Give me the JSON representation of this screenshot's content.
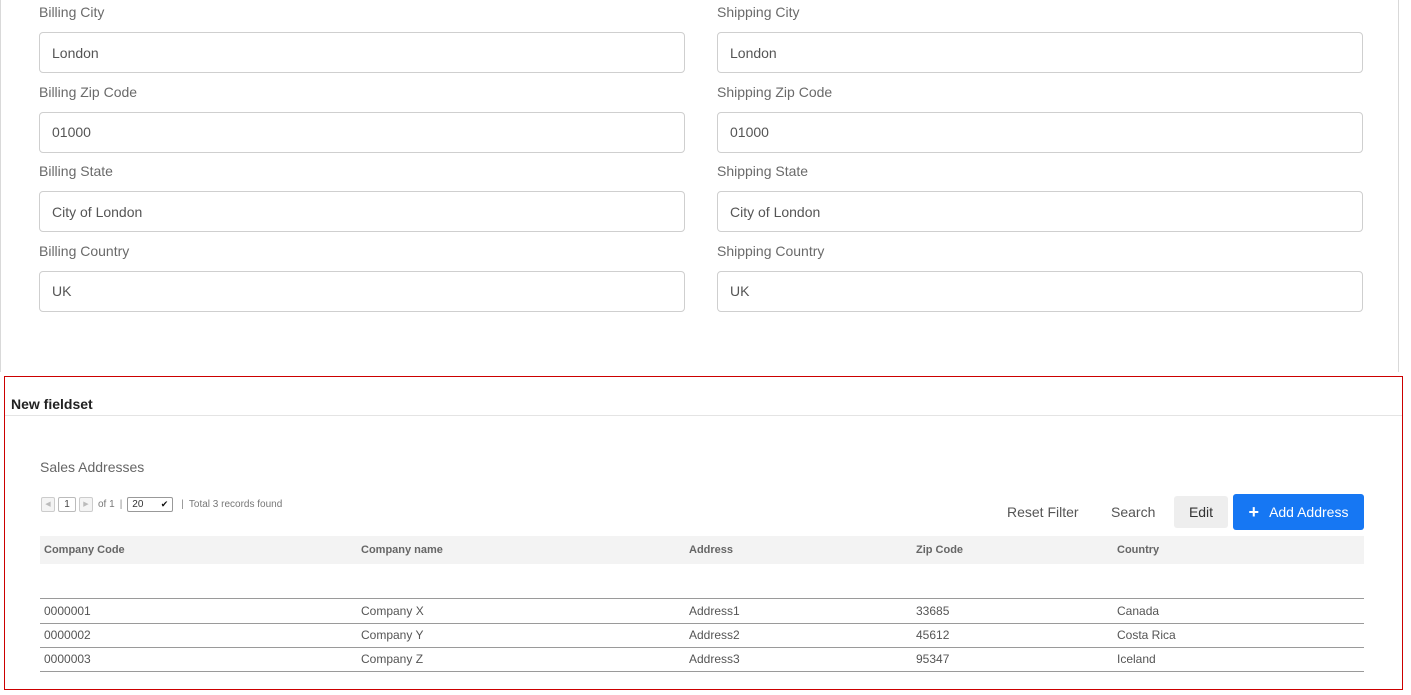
{
  "billing": {
    "city_label": "Billing City",
    "city_value": "London",
    "zip_label": "Billing Zip Code",
    "zip_value": "01000",
    "state_label": "Billing State",
    "state_value": "City of London",
    "country_label": "Billing Country",
    "country_value": "UK"
  },
  "shipping": {
    "city_label": "Shipping City",
    "city_value": "London",
    "zip_label": "Shipping Zip Code",
    "zip_value": "01000",
    "state_label": "Shipping State",
    "state_value": "City of London",
    "country_label": "Shipping Country",
    "country_value": "UK"
  },
  "fieldset": {
    "title": "New fieldset"
  },
  "grid": {
    "title": "Sales Addresses",
    "pager": {
      "prev_icon": "caret-left-icon",
      "next_icon": "caret-right-icon",
      "page": "1",
      "of_text": "of 1",
      "separator": "|",
      "page_size": "20",
      "total_text": "Total 3 records found"
    },
    "toolbar": {
      "reset_filter": "Reset Filter",
      "search": "Search",
      "edit": "Edit",
      "add_address": "Add Address",
      "add_icon": "plus-icon"
    },
    "columns": [
      "Company Code",
      "Company name",
      "Address",
      "Zip Code",
      "Country"
    ],
    "rows": [
      [
        "0000001",
        "Company X",
        "Address1",
        "33685",
        "Canada"
      ],
      [
        "0000002",
        "Company Y",
        "Address2",
        "45612",
        "Costa Rica"
      ],
      [
        "0000003",
        "Company Z",
        "Address3",
        "95347",
        "Iceland"
      ]
    ]
  },
  "colors": {
    "accent": "#1677f3",
    "highlight_border": "#cc0000"
  }
}
